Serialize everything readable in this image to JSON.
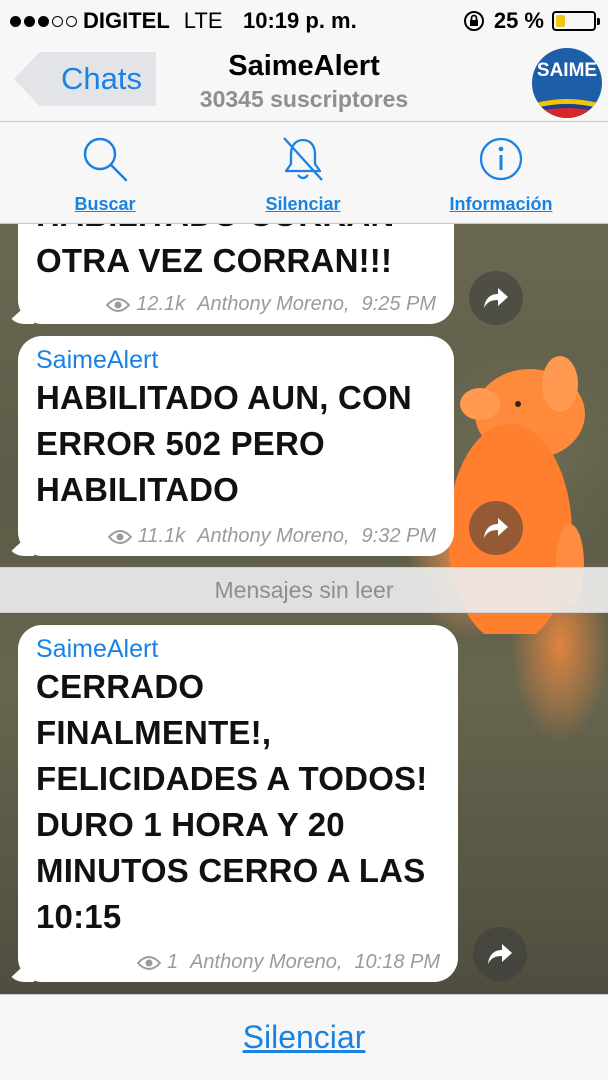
{
  "status_bar": {
    "carrier": "DIGITEL",
    "network": "LTE",
    "time": "10:19 p. m.",
    "battery_percent": "25 %",
    "battery_level": 0.25,
    "signal_bars_filled": 3,
    "signal_bars_total": 5
  },
  "nav": {
    "back_label": "Chats",
    "title": "SaimeAlert",
    "subtitle": "30345 suscriptores",
    "avatar_text": "SAIME"
  },
  "toolbar": {
    "search_label": "Buscar",
    "mute_label": "Silenciar",
    "info_label": "Información"
  },
  "messages": [
    {
      "text": "HABILITADO CORRAN OTRA VEZ CORRAN!!!",
      "views": "12.1k",
      "author": "Anthony Moreno,",
      "time": "9:25 PM"
    },
    {
      "sender": "SaimeAlert",
      "text": "HABILITADO AUN, CON ERROR 502 PERO HABILITADO",
      "views": "11.1k",
      "author": "Anthony Moreno,",
      "time": "9:32 PM"
    },
    {
      "sender": "SaimeAlert",
      "text": "CERRADO FINALMENTE!, FELICIDADES A TODOS! DURO 1 HORA Y 20 MINUTOS CERRO A LAS 10:15",
      "views": "1",
      "author": "Anthony Moreno,",
      "time": "10:18 PM"
    }
  ],
  "unread_separator": "Mensajes sin leer",
  "bottom": {
    "mute_label": "Silenciar"
  },
  "colors": {
    "accent": "#1a82e2",
    "battery": "#f2c618"
  }
}
